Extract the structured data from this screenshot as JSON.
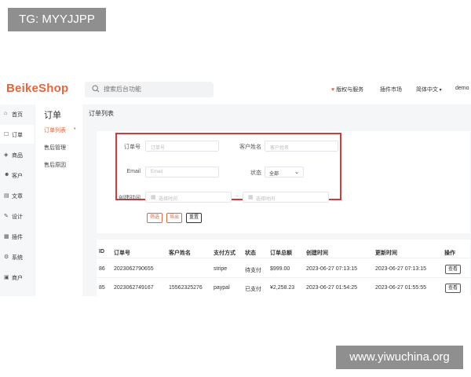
{
  "watermarks": {
    "top": "TG: MYYJJPP",
    "bottom": "www.yiwuchina.org"
  },
  "header": {
    "logo": "BeikeShop",
    "search_placeholder": "搜索后台功能",
    "links": {
      "copyright": "版权与服务",
      "plugin_market": "插件市场",
      "language": "简体中文",
      "user": "demo"
    },
    "icons": {
      "search": "search-icon",
      "copyright": "heart-icon",
      "language_caret": "chevron-down-icon"
    }
  },
  "sidebar": {
    "items": [
      {
        "label": "首页",
        "icon": "⌂"
      },
      {
        "label": "订单",
        "icon": "☐"
      },
      {
        "label": "商品",
        "icon": "◈"
      },
      {
        "label": "客户",
        "icon": "☻"
      },
      {
        "label": "文章",
        "icon": "▤"
      },
      {
        "label": "设计",
        "icon": "✎"
      },
      {
        "label": "插件",
        "icon": "▦"
      },
      {
        "label": "系统",
        "icon": "⚙"
      },
      {
        "label": "商户",
        "icon": "▣"
      }
    ]
  },
  "subnav": {
    "title": "订单",
    "items": [
      {
        "label": "订单列表"
      },
      {
        "label": "售后管理"
      },
      {
        "label": "售后原因"
      }
    ]
  },
  "main": {
    "title": "订单列表",
    "filters": {
      "order_no_label": "订单号",
      "order_no_placeholder": "订单号",
      "customer_label": "客户姓名",
      "customer_placeholder": "客户姓名",
      "email_label": "Email",
      "email_placeholder": "Email",
      "status_label": "状态",
      "status_value": "全部",
      "created_label": "创建时间",
      "date_from_placeholder": "选择时间",
      "date_to_placeholder": "选择时间",
      "date_separator": "-"
    },
    "buttons": {
      "filter": "筛选",
      "export": "导出",
      "reset": "重置"
    },
    "table": {
      "columns": [
        "ID",
        "订单号",
        "客户姓名",
        "支付方式",
        "状态",
        "订单总额",
        "创建时间",
        "更新时间",
        "操作"
      ],
      "rows": [
        {
          "id": "86",
          "number": "2023062790655",
          "customer": "",
          "payment": "stripe",
          "status": "待支付",
          "total": "$999.00",
          "created": "2023-06-27 07:13:15",
          "updated": "2023-06-27 07:13:15",
          "action": "查看"
        },
        {
          "id": "85",
          "number": "2023062749167",
          "customer": "15562325276",
          "payment": "paypal",
          "status": "已支付",
          "total": "¥2,258.23",
          "created": "2023-06-27 01:54:25",
          "updated": "2023-06-27 01:55:55",
          "action": "查看"
        }
      ]
    }
  },
  "colors": {
    "brand": "#e8643a",
    "highlight": "#d9383a"
  }
}
